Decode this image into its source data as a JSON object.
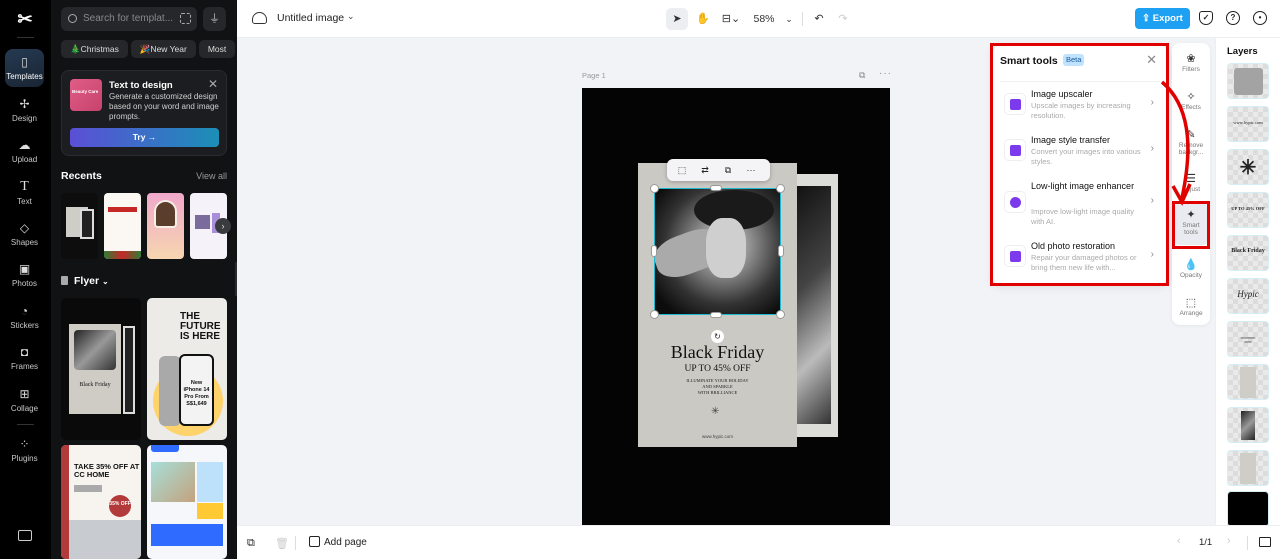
{
  "app": {
    "logo": "CapCut"
  },
  "rail": {
    "items": [
      {
        "label": "Templates",
        "icon": "templates-icon",
        "active": true
      },
      {
        "label": "Design",
        "icon": "design-icon"
      },
      {
        "label": "Upload",
        "icon": "upload-icon"
      },
      {
        "label": "Text",
        "icon": "text-icon"
      },
      {
        "label": "Shapes",
        "icon": "shapes-icon"
      },
      {
        "label": "Photos",
        "icon": "photos-icon"
      },
      {
        "label": "Stickers",
        "icon": "stickers-icon"
      },
      {
        "label": "Frames",
        "icon": "frames-icon"
      },
      {
        "label": "Collage",
        "icon": "collage-icon"
      },
      {
        "label": "Plugins",
        "icon": "plugins-icon"
      }
    ]
  },
  "panel": {
    "search_placeholder": "Search for templat...",
    "chips": [
      "🎄Christmas",
      "🎉New Year",
      "Most"
    ],
    "text_to_design": {
      "thumb_label": "Beauty Care",
      "title": "Text to design",
      "description": "Generate a customized design based on your word and image prompts.",
      "button": "Try →"
    },
    "recents_title": "Recents",
    "view_all": "View all",
    "flyer_title": "Flyer",
    "cards": {
      "c1_title": "Black Friday",
      "c2_headline": "THE FUTURE IS HERE",
      "c2_price": "New iPhone 14 Pro From S$1,649",
      "c3_headline": "TAKE 35% OFF AT CC HOME",
      "c3_badge": "35% OFF"
    }
  },
  "topbar": {
    "doc_title": "Untitled image",
    "zoom": "58%",
    "export_label": "Export"
  },
  "canvas": {
    "page_label": "Page 1",
    "poster": {
      "title": "Black Friday",
      "subtitle": "UP TO 45% OFF",
      "body": "ILLUMINATE YOUR HOLIDAY\nAND SPARKLE\nWITH BRILLIANCE",
      "url": "www.hypic.com"
    }
  },
  "smart_tools": {
    "title": "Smart tools",
    "badge": "Beta",
    "tools": [
      {
        "name": "Image upscaler",
        "description": "Upscale images by increasing resolution."
      },
      {
        "name": "Image style transfer",
        "description": "Convert your images into various styles."
      },
      {
        "name": "Low-light image enhancer",
        "description": "Improve low-light image quality with AI."
      },
      {
        "name": "Old photo restoration",
        "description": "Repair your damaged photos or bring them new life with..."
      }
    ]
  },
  "right_toolbar": {
    "items": [
      {
        "label": "Filters"
      },
      {
        "label": "Effects"
      },
      {
        "label": "Remove backgr..."
      },
      {
        "label": "Adjust"
      },
      {
        "label": "Smart tools",
        "active": true
      },
      {
        "label": "Opacity"
      },
      {
        "label": "Arrange"
      }
    ]
  },
  "layers": {
    "title": "Layers",
    "items": [
      "gray square",
      "www.hypic.com",
      "flower ornament",
      "UP TO 45% OFF",
      "Black Friday",
      "Hypic",
      "body text",
      "paper rect",
      "photo",
      "paper rect 2",
      "background"
    ],
    "texts": {
      "url": "www.hypic.com",
      "sub": "UP TO 45% OFF",
      "title": "Black Friday",
      "script": "Hypic"
    }
  },
  "bottombar": {
    "add_page": "Add page",
    "pager": "1/1"
  },
  "colors": {
    "accent": "#1ea1f2",
    "highlight": "#e00000",
    "tool_purple": "#7c3aed",
    "selection": "#1bb8cf"
  }
}
